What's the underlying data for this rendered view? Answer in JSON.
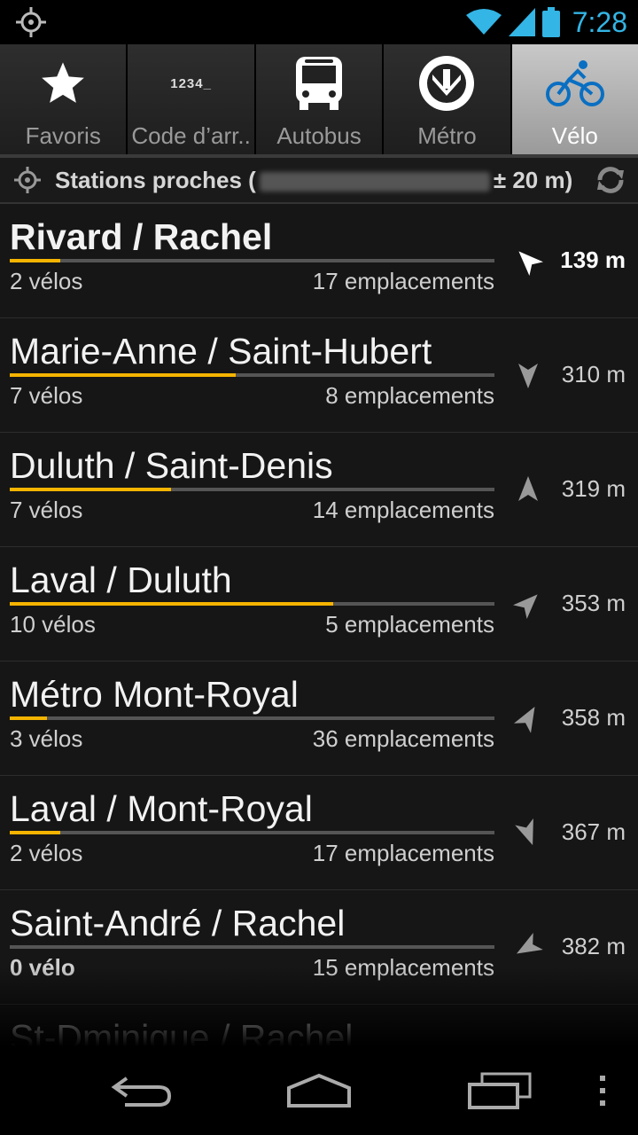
{
  "statusbar": {
    "time": "7:28",
    "accent": "#33b5e5"
  },
  "tabs": [
    {
      "label": "Favoris",
      "icon": "star-icon",
      "active": false
    },
    {
      "label": "Code d’arr..",
      "icon": "stop-code-icon",
      "icon_text": "1234_",
      "active": false
    },
    {
      "label": "Autobus",
      "icon": "bus-icon",
      "active": false
    },
    {
      "label": "Métro",
      "icon": "metro-icon",
      "active": false
    },
    {
      "label": "Vélo",
      "icon": "bicycle-icon",
      "active": true
    }
  ],
  "location": {
    "prefix": "Stations proches (",
    "suffix": "± 20 m)"
  },
  "stations": [
    {
      "name": "Rivard / Rachel",
      "bikes": "2 vélos",
      "docks": "17 emplacements",
      "distance": "139 m",
      "fill_fraction": 0.105,
      "heading_deg": -45
    },
    {
      "name": "Marie-Anne / Saint-Hubert",
      "bikes": "7 vélos",
      "docks": "8 emplacements",
      "distance": "310 m",
      "fill_fraction": 0.467,
      "heading_deg": 180
    },
    {
      "name": "Duluth / Saint-Denis",
      "bikes": "7 vélos",
      "docks": "14 emplacements",
      "distance": "319 m",
      "fill_fraction": 0.333,
      "heading_deg": 0
    },
    {
      "name": "Laval / Duluth",
      "bikes": "10 vélos",
      "docks": "5 emplacements",
      "distance": "353 m",
      "fill_fraction": 0.667,
      "heading_deg": 45
    },
    {
      "name": "Métro Mont-Royal",
      "bikes": "3 vélos",
      "docks": "36 emplacements",
      "distance": "358 m",
      "fill_fraction": 0.077,
      "heading_deg": 30
    },
    {
      "name": "Laval / Mont-Royal",
      "bikes": "2 vélos",
      "docks": "17 emplacements",
      "distance": "367 m",
      "fill_fraction": 0.105,
      "heading_deg": 160
    },
    {
      "name": "Saint-André / Rachel",
      "bikes": "0 vélo",
      "docks": "15 emplacements",
      "distance": "382 m",
      "fill_fraction": 0,
      "heading_deg": -120
    },
    {
      "name": "St-Dminique / Rachel",
      "bikes": "",
      "docks": "",
      "distance": "",
      "fill_fraction": 0,
      "heading_deg": 0
    }
  ],
  "colors": {
    "availability_bar": "#f5b400",
    "active_tab": "#b0b0b0"
  }
}
